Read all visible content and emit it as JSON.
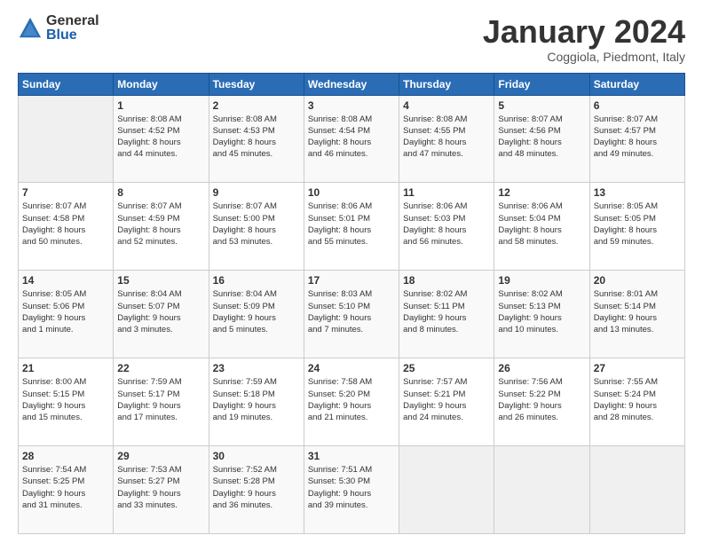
{
  "logo": {
    "general": "General",
    "blue": "Blue"
  },
  "header": {
    "month": "January 2024",
    "location": "Coggiola, Piedmont, Italy"
  },
  "days_of_week": [
    "Sunday",
    "Monday",
    "Tuesday",
    "Wednesday",
    "Thursday",
    "Friday",
    "Saturday"
  ],
  "weeks": [
    [
      {
        "day": "",
        "info": ""
      },
      {
        "day": "1",
        "info": "Sunrise: 8:08 AM\nSunset: 4:52 PM\nDaylight: 8 hours\nand 44 minutes."
      },
      {
        "day": "2",
        "info": "Sunrise: 8:08 AM\nSunset: 4:53 PM\nDaylight: 8 hours\nand 45 minutes."
      },
      {
        "day": "3",
        "info": "Sunrise: 8:08 AM\nSunset: 4:54 PM\nDaylight: 8 hours\nand 46 minutes."
      },
      {
        "day": "4",
        "info": "Sunrise: 8:08 AM\nSunset: 4:55 PM\nDaylight: 8 hours\nand 47 minutes."
      },
      {
        "day": "5",
        "info": "Sunrise: 8:07 AM\nSunset: 4:56 PM\nDaylight: 8 hours\nand 48 minutes."
      },
      {
        "day": "6",
        "info": "Sunrise: 8:07 AM\nSunset: 4:57 PM\nDaylight: 8 hours\nand 49 minutes."
      }
    ],
    [
      {
        "day": "7",
        "info": "Sunrise: 8:07 AM\nSunset: 4:58 PM\nDaylight: 8 hours\nand 50 minutes."
      },
      {
        "day": "8",
        "info": "Sunrise: 8:07 AM\nSunset: 4:59 PM\nDaylight: 8 hours\nand 52 minutes."
      },
      {
        "day": "9",
        "info": "Sunrise: 8:07 AM\nSunset: 5:00 PM\nDaylight: 8 hours\nand 53 minutes."
      },
      {
        "day": "10",
        "info": "Sunrise: 8:06 AM\nSunset: 5:01 PM\nDaylight: 8 hours\nand 55 minutes."
      },
      {
        "day": "11",
        "info": "Sunrise: 8:06 AM\nSunset: 5:03 PM\nDaylight: 8 hours\nand 56 minutes."
      },
      {
        "day": "12",
        "info": "Sunrise: 8:06 AM\nSunset: 5:04 PM\nDaylight: 8 hours\nand 58 minutes."
      },
      {
        "day": "13",
        "info": "Sunrise: 8:05 AM\nSunset: 5:05 PM\nDaylight: 8 hours\nand 59 minutes."
      }
    ],
    [
      {
        "day": "14",
        "info": "Sunrise: 8:05 AM\nSunset: 5:06 PM\nDaylight: 9 hours\nand 1 minute."
      },
      {
        "day": "15",
        "info": "Sunrise: 8:04 AM\nSunset: 5:07 PM\nDaylight: 9 hours\nand 3 minutes."
      },
      {
        "day": "16",
        "info": "Sunrise: 8:04 AM\nSunset: 5:09 PM\nDaylight: 9 hours\nand 5 minutes."
      },
      {
        "day": "17",
        "info": "Sunrise: 8:03 AM\nSunset: 5:10 PM\nDaylight: 9 hours\nand 7 minutes."
      },
      {
        "day": "18",
        "info": "Sunrise: 8:02 AM\nSunset: 5:11 PM\nDaylight: 9 hours\nand 8 minutes."
      },
      {
        "day": "19",
        "info": "Sunrise: 8:02 AM\nSunset: 5:13 PM\nDaylight: 9 hours\nand 10 minutes."
      },
      {
        "day": "20",
        "info": "Sunrise: 8:01 AM\nSunset: 5:14 PM\nDaylight: 9 hours\nand 13 minutes."
      }
    ],
    [
      {
        "day": "21",
        "info": "Sunrise: 8:00 AM\nSunset: 5:15 PM\nDaylight: 9 hours\nand 15 minutes."
      },
      {
        "day": "22",
        "info": "Sunrise: 7:59 AM\nSunset: 5:17 PM\nDaylight: 9 hours\nand 17 minutes."
      },
      {
        "day": "23",
        "info": "Sunrise: 7:59 AM\nSunset: 5:18 PM\nDaylight: 9 hours\nand 19 minutes."
      },
      {
        "day": "24",
        "info": "Sunrise: 7:58 AM\nSunset: 5:20 PM\nDaylight: 9 hours\nand 21 minutes."
      },
      {
        "day": "25",
        "info": "Sunrise: 7:57 AM\nSunset: 5:21 PM\nDaylight: 9 hours\nand 24 minutes."
      },
      {
        "day": "26",
        "info": "Sunrise: 7:56 AM\nSunset: 5:22 PM\nDaylight: 9 hours\nand 26 minutes."
      },
      {
        "day": "27",
        "info": "Sunrise: 7:55 AM\nSunset: 5:24 PM\nDaylight: 9 hours\nand 28 minutes."
      }
    ],
    [
      {
        "day": "28",
        "info": "Sunrise: 7:54 AM\nSunset: 5:25 PM\nDaylight: 9 hours\nand 31 minutes."
      },
      {
        "day": "29",
        "info": "Sunrise: 7:53 AM\nSunset: 5:27 PM\nDaylight: 9 hours\nand 33 minutes."
      },
      {
        "day": "30",
        "info": "Sunrise: 7:52 AM\nSunset: 5:28 PM\nDaylight: 9 hours\nand 36 minutes."
      },
      {
        "day": "31",
        "info": "Sunrise: 7:51 AM\nSunset: 5:30 PM\nDaylight: 9 hours\nand 39 minutes."
      },
      {
        "day": "",
        "info": ""
      },
      {
        "day": "",
        "info": ""
      },
      {
        "day": "",
        "info": ""
      }
    ]
  ]
}
